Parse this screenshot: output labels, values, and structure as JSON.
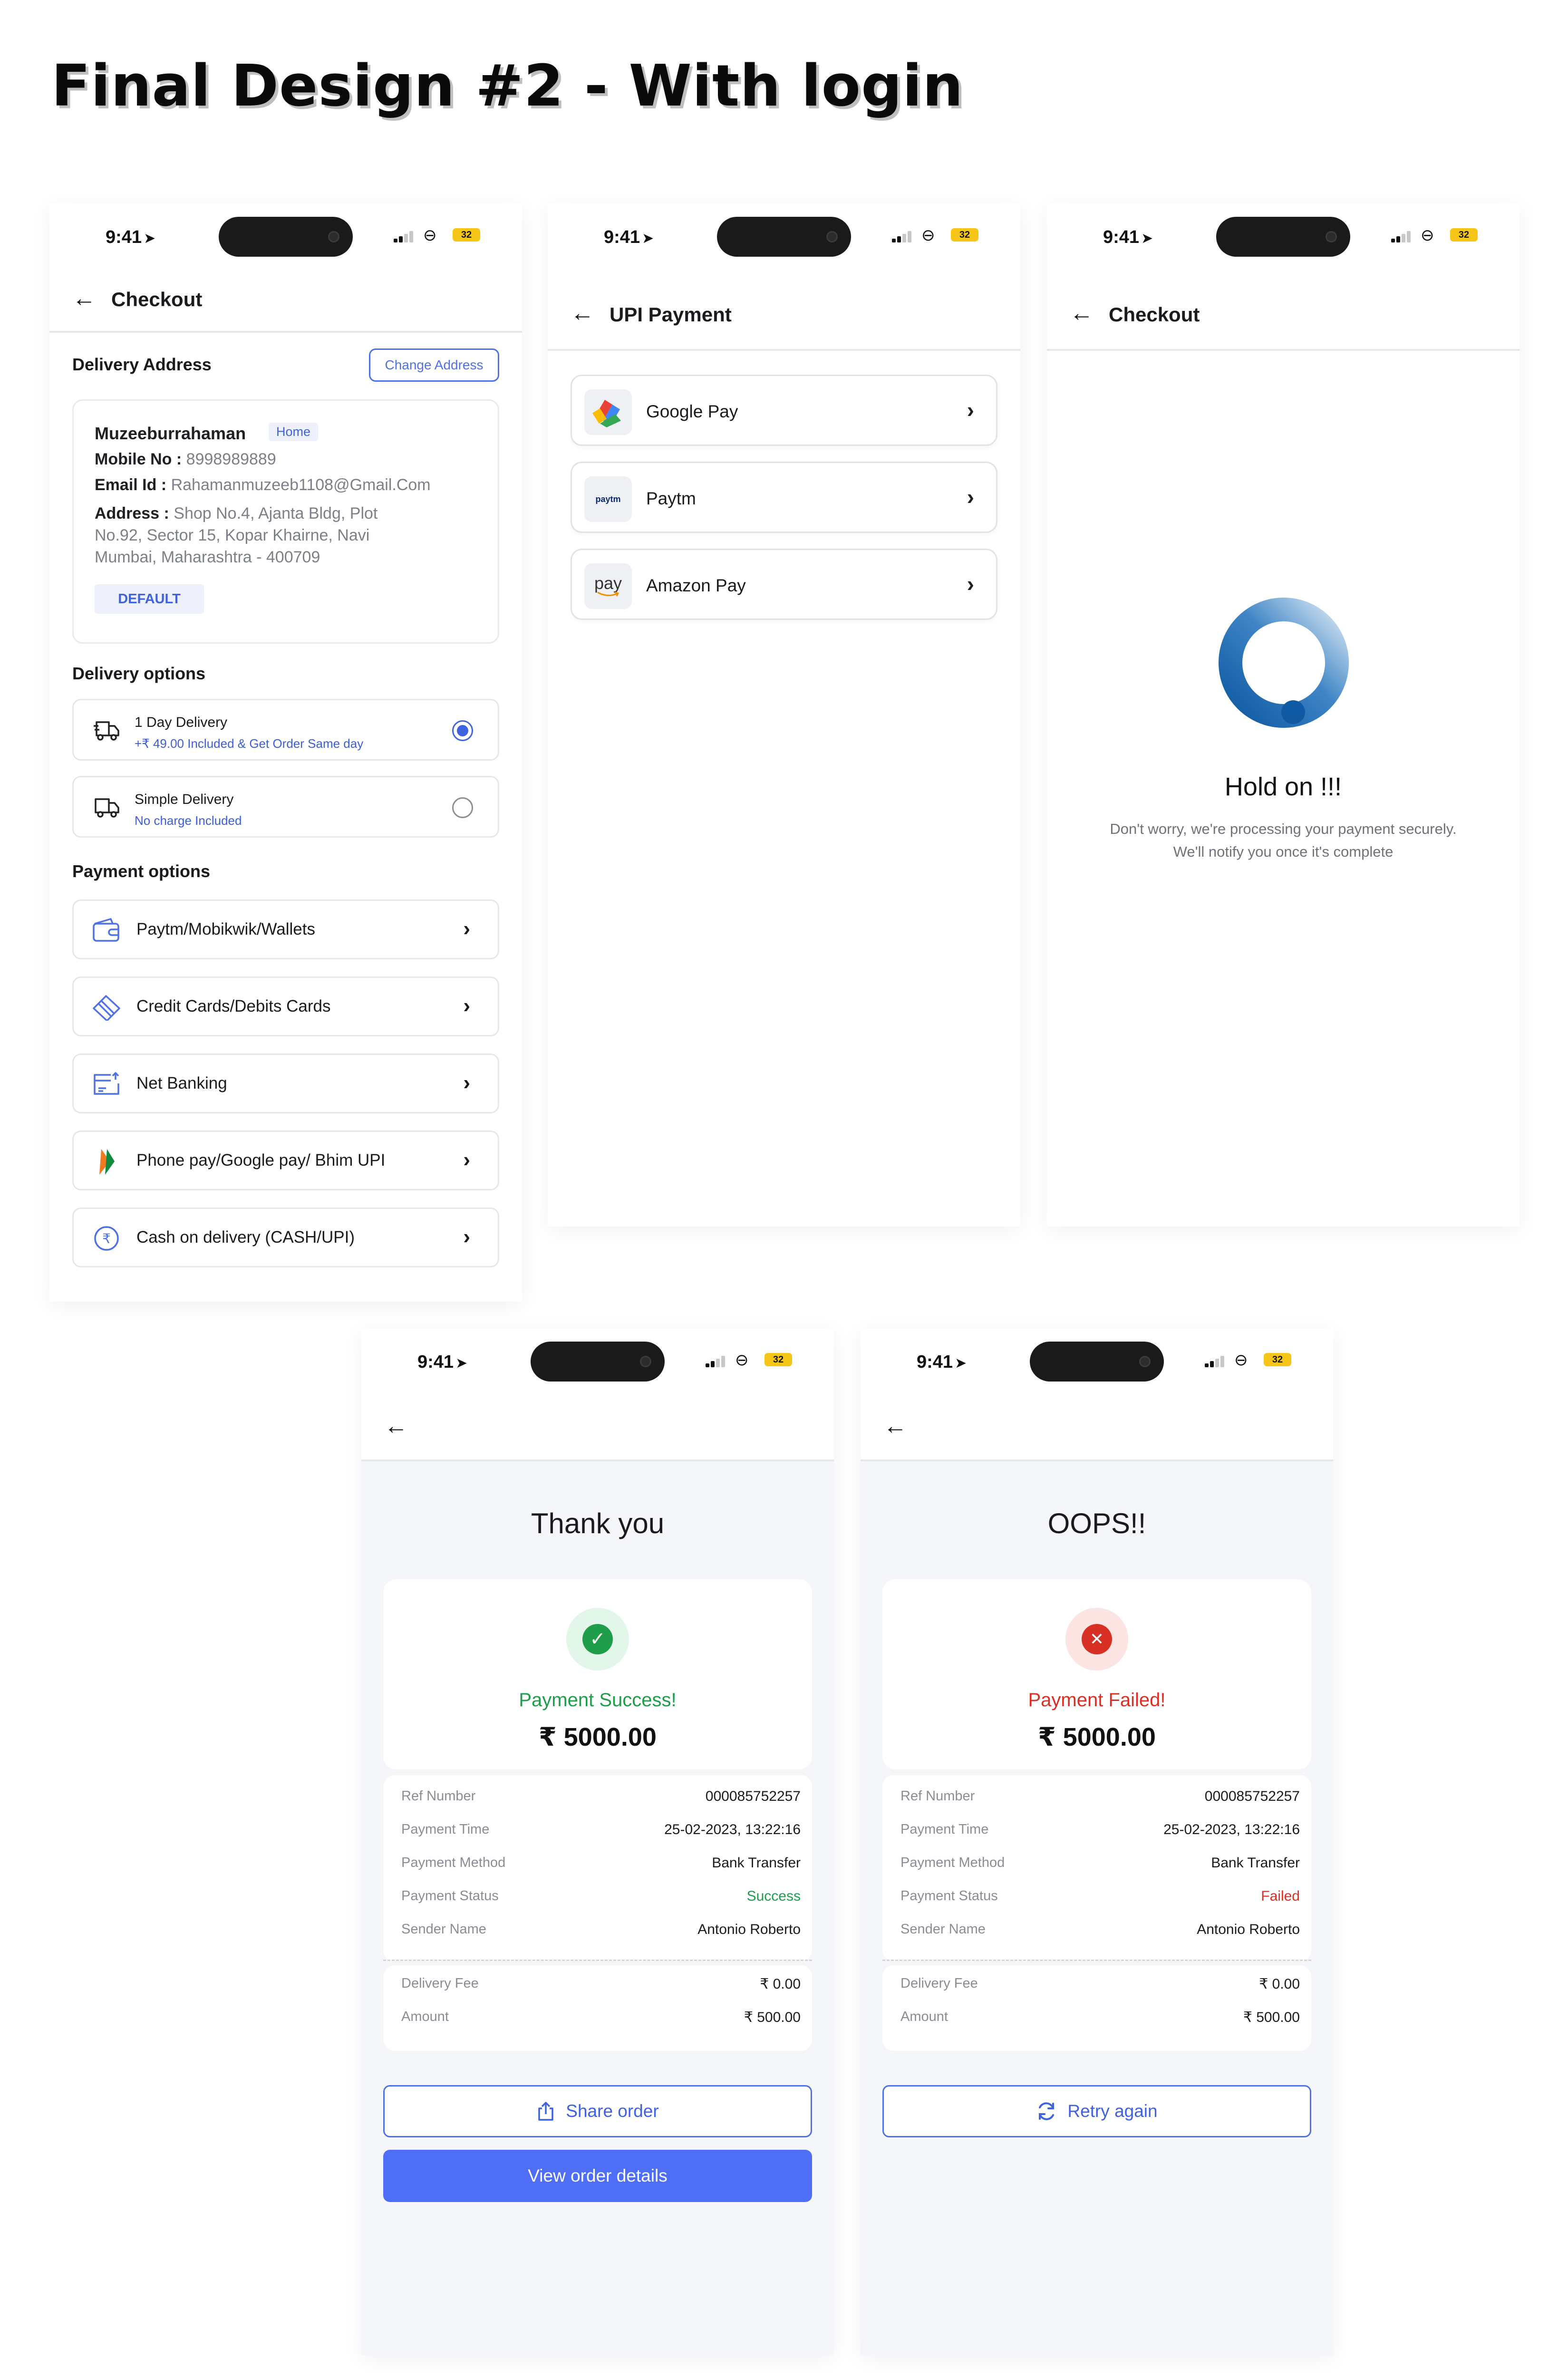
{
  "heading": "Final Design #2 - With login",
  "status_bar": {
    "time": "9:41",
    "battery": "32"
  },
  "checkout": {
    "title": "Checkout",
    "delivery_address_title": "Delivery Address",
    "change_address": "Change Address",
    "name": "Muzeeburrahaman",
    "tag": "Home",
    "mobile_label": "Mobile No :",
    "mobile": "8998989889",
    "email_label": "Email Id :",
    "email": "Rahamanmuzeeb1108@Gmail.Com",
    "address_label": "Address :",
    "address_line1": "Shop No.4, Ajanta Bldg, Plot",
    "address_line2": "No.92, Sector 15, Kopar Khairne, Navi",
    "address_line3": "Mumbai, Maharashtra - 400709",
    "default_badge": "DEFAULT",
    "delivery_options_title": "Delivery options",
    "delivery_options": [
      {
        "title": "1 Day Delivery",
        "subtitle": "+₹ 49.00 Included & Get Order Same day",
        "selected": true
      },
      {
        "title": "Simple Delivery",
        "subtitle": "No charge Included",
        "selected": false
      }
    ],
    "payment_options_title": "Payment options",
    "payment_options": [
      {
        "label": "Paytm/Mobikwik/Wallets",
        "icon": "wallet-icon"
      },
      {
        "label": "Credit Cards/Debits Cards",
        "icon": "card-icon"
      },
      {
        "label": "Net Banking",
        "icon": "bank-icon"
      },
      {
        "label": "Phone pay/Google pay/ Bhim UPI",
        "icon": "bhim-upi-icon"
      },
      {
        "label": "Cash on delivery (CASH/UPI)",
        "icon": "rupee-icon"
      }
    ]
  },
  "upi": {
    "title": "UPI Payment",
    "options": [
      {
        "label": "Google Pay",
        "icon": "google-pay-icon",
        "logo_text": ""
      },
      {
        "label": "Paytm",
        "icon": "paytm-icon",
        "logo_text": "paytm"
      },
      {
        "label": "Amazon Pay",
        "icon": "amazon-pay-icon",
        "logo_text": "pay"
      }
    ]
  },
  "processing": {
    "title": "Checkout",
    "heading": "Hold on !!!",
    "line1": "Don't worry, we're processing your payment securely.",
    "line2": "We'll notify you once it's complete"
  },
  "success": {
    "title": "Thank you",
    "status": "Payment Success!",
    "amount": "₹ 5000.00",
    "details": [
      {
        "key": "Ref Number",
        "value": "000085752257"
      },
      {
        "key": "Payment Time",
        "value": "25-02-2023, 13:22:16"
      },
      {
        "key": "Payment Method",
        "value": "Bank Transfer"
      },
      {
        "key": "Payment Status",
        "value": "Success"
      },
      {
        "key": "Sender Name",
        "value": "Antonio Roberto"
      }
    ],
    "fees": [
      {
        "key": "Delivery Fee",
        "value": "₹ 0.00"
      },
      {
        "key": "Amount",
        "value": "₹ 500.00"
      }
    ],
    "share_button": "Share order",
    "view_button": "View order details"
  },
  "failed": {
    "title": "OOPS!!",
    "status": "Payment Failed!",
    "amount": "₹ 5000.00",
    "details": [
      {
        "key": "Ref Number",
        "value": "000085752257"
      },
      {
        "key": "Payment Time",
        "value": "25-02-2023, 13:22:16"
      },
      {
        "key": "Payment Method",
        "value": "Bank Transfer"
      },
      {
        "key": "Payment Status",
        "value": "Failed"
      },
      {
        "key": "Sender Name",
        "value": "Antonio Roberto"
      }
    ],
    "fees": [
      {
        "key": "Delivery Fee",
        "value": "₹ 0.00"
      },
      {
        "key": "Amount",
        "value": "₹ 500.00"
      }
    ],
    "retry_button": "Retry again"
  },
  "colors": {
    "accent": "#4E71E6",
    "primary_button": "#4F6EF7",
    "success": "#1E9E4A",
    "error": "#D93025",
    "spinner": "#1E63A8"
  }
}
